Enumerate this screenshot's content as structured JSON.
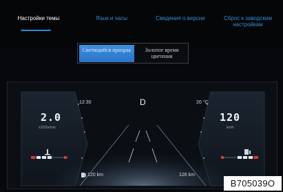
{
  "tabs": [
    {
      "label": "Настройки темы",
      "active": true
    },
    {
      "label": "Язык и часы",
      "active": false
    },
    {
      "label": "Сведения о версии",
      "active": false
    },
    {
      "label": "Сброс к заводским настройкам",
      "active": false
    }
  ],
  "theme_options": [
    {
      "label": "Светящийся призрак",
      "selected": true
    },
    {
      "label": "Золотое время цветения",
      "selected": false
    }
  ],
  "cluster": {
    "time": "12:30",
    "gear": "D",
    "outside_temp": "20 °C",
    "rpm_value": "2.0",
    "rpm_unit": "x1000r/min",
    "speed_value": "120",
    "speed_unit": "km/h",
    "range": "120 km",
    "odometer": "126 km"
  },
  "figure_code": "B705039O",
  "colors": {
    "accent": "#2e8ad8",
    "tab_inactive": "#2f8fd6",
    "background": "#07080b",
    "warning_red": "#d63a3a"
  },
  "icons": [
    "coolant-temp-icon",
    "fuel-pump-icon"
  ]
}
